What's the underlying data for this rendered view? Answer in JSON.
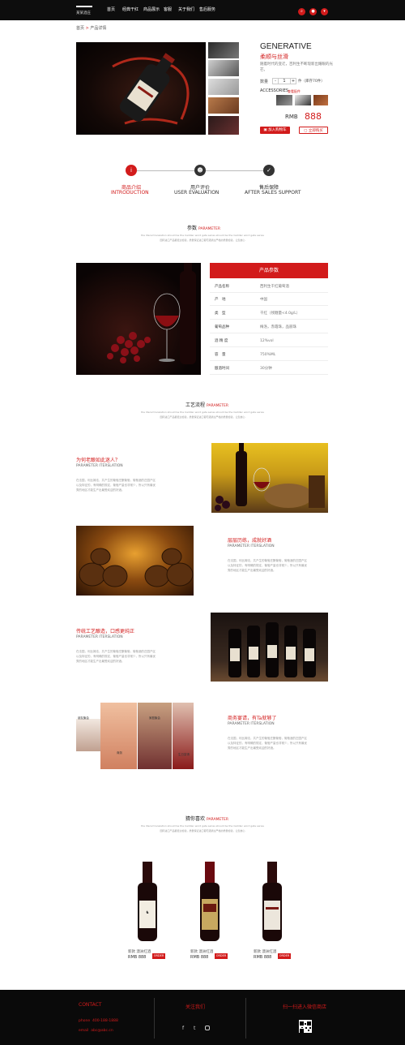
{
  "header": {
    "logo_text": "某某酒庄",
    "nav": [
      "首页",
      "经典干红",
      "商品展示",
      "客服",
      "关于我们",
      "售后服务"
    ],
    "icons": [
      "search-icon",
      "user-icon",
      "cart-icon"
    ]
  },
  "breadcrumb": {
    "home": "首页",
    "sep": ">",
    "current": "产品详情"
  },
  "product": {
    "name": "GENERATIVE",
    "subtitle": "柔顺与丝滑",
    "desc": "随着时代的变迁，百利生不断现新出耀眼的光芒。",
    "qty_label": "数量",
    "qty_value": "1",
    "stock": "件（库存70件）",
    "accessories_label": "ACCESSORIES",
    "accessories_link": "查看配件",
    "price_label": "RMB",
    "price": "888",
    "add_cart": "加入购物车",
    "buy_now": "立即购买"
  },
  "steps": [
    {
      "zh": "商品介绍",
      "en": "INTRODUCTION"
    },
    {
      "zh": "用户评价",
      "en": "USER EVALUATION"
    },
    {
      "zh": "售后保障",
      "en": "AFTER SALES SUPPORT"
    }
  ],
  "params_section": {
    "title": "参数",
    "title_en": "PARAMETER",
    "sub1": "the literal translation should be the Cadillac word gate series should be the Cadillac word gate series",
    "sub2": "国际进口产品都经过检验，质量保证进口葡萄酒通过严格的质量检验，让您放心",
    "table_title": "产品参数",
    "rows": [
      {
        "k": "产品名称",
        "v": "西利生干红葡萄酒"
      },
      {
        "k": "产　地",
        "v": "中国"
      },
      {
        "k": "类　型",
        "v": "干红（残糖量<4.0g/L）"
      },
      {
        "k": "葡萄品种",
        "v": "梅洛，赤霞珠，品丽珠"
      },
      {
        "k": "酒 精 度",
        "v": "12%vol"
      },
      {
        "k": "容　量",
        "v": "750%ML"
      },
      {
        "k": "酿酒时间",
        "v": "30分钟"
      }
    ]
  },
  "craft_section": {
    "title": "工艺流程",
    "title_en": "PARAMETER",
    "sub1": "the literal translation should be the Cadillac word gate series should be the Cadillac word gate series",
    "sub2": "国际进口产品都经过检验，质量保证进口葡萄酒通过严格的质量检验，让您放心",
    "items": [
      {
        "h": "为何老酿如此迷人？",
        "en": "PARAMETER ITERSLATION",
        "p": "在法国，利比姆法，共产生的葡萄庄酿葡萄，葡萄酒的庄园产区以及特征的，有明确的规定，葡萄产量也非常少，所以只有最优秀的地区才能生产出最受欢迎的好酒。"
      },
      {
        "h": "层层历练，成就好酒",
        "en": "PARAMETER ITERSLATION",
        "p": "在法国，利比姆法，共产生的葡萄庄酿葡萄，葡萄酒的庄园产区以及特征的，有明确的规定，葡萄产量也非常少，所以只有最优秀的地区才能生产出最受欢迎的好酒。"
      },
      {
        "h": "传统工艺酿造，口感更纯正",
        "en": "PARAMETER ITERSLATION",
        "p": "在法国，利比姆法，共产生的葡萄庄酿葡萄，葡萄酒的庄园产区以及特征的，有明确的规定，葡萄产量也非常少，所以只有最优秀的地区才能生产出最受欢迎的好酒。"
      },
      {
        "h": "商务宴请，有Ta就够了",
        "en": "PARAMETER ITERSLATION",
        "p": "在法国，利比姆法，共产生的葡萄庄酿葡萄，葡萄酒的庄园产区以及特征的，有明确的规定，葡萄产量也非常少，所以只有最优秀的地区才能生产出最受欢迎的好酒。"
      }
    ],
    "collage_labels": [
      "朋友聚会",
      "家庭聚会",
      "商务",
      "生日宴请"
    ]
  },
  "like_section": {
    "title": "猜你喜欢",
    "title_en": "PARAMETER",
    "sub1": "the literal translation should be the Cadillac word gate series should be the Cadillac word gate series",
    "sub2": "国际进口产品都经过检验，质量保证进口葡萄酒通过严格的质量检验，让您放心",
    "products": [
      {
        "name": "新款 澳洲红酒",
        "rmb": "RMB",
        "price": "888",
        "order": "ORDER"
      },
      {
        "name": "新款 澳洲红酒",
        "rmb": "RMB",
        "price": "888",
        "order": "ORDER"
      },
      {
        "name": "新款 澳洲红酒",
        "rmb": "RMB",
        "price": "888",
        "order": "ORDER"
      }
    ]
  },
  "footer": {
    "contact": "CONTACT",
    "phone_label": "phone",
    "phone": "400-188-1888",
    "email_label": "email",
    "email": "abc@abc.cn",
    "follow": "关注我们",
    "qr_text": "扫一扫进入微信商店",
    "social": [
      "facebook-icon",
      "twitter-icon",
      "instagram-icon"
    ]
  },
  "colors": {
    "accent": "#d21b1b",
    "dark": "#0d0d0d"
  }
}
